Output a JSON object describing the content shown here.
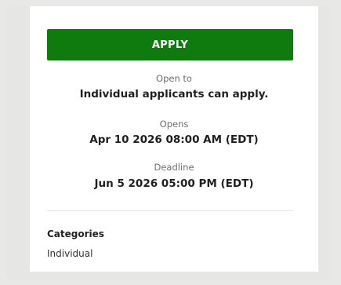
{
  "apply_button": {
    "label": "APPLY"
  },
  "open_to": {
    "label": "Open to",
    "value": "Individual applicants can apply."
  },
  "opens": {
    "label": "Opens",
    "value": "Apr 10 2026 08:00 AM (EDT)"
  },
  "deadline": {
    "label": "Deadline",
    "value": "Jun 5 2026 05:00 PM (EDT)"
  },
  "categories": {
    "title": "Categories",
    "value": "Individual"
  }
}
